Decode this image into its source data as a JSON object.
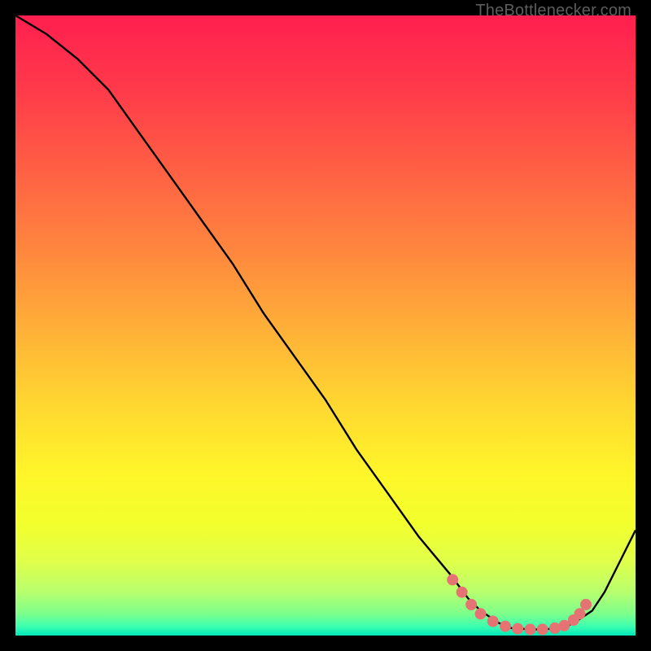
{
  "watermark": "TheBottlenecker.com",
  "chart_data": {
    "type": "line",
    "title": "",
    "xlabel": "",
    "ylabel": "",
    "xlim": [
      0,
      100
    ],
    "ylim": [
      0,
      100
    ],
    "grid": false,
    "series": [
      {
        "name": "curve",
        "color": "#000000",
        "x": [
          0,
          5,
          10,
          15,
          20,
          25,
          30,
          35,
          40,
          45,
          50,
          55,
          60,
          65,
          70,
          73,
          75,
          78,
          80,
          83,
          85,
          88,
          90,
          93,
          95,
          100
        ],
        "y": [
          100,
          97,
          93,
          88,
          81,
          74,
          67,
          60,
          52,
          45,
          38,
          30,
          23,
          16,
          10,
          6,
          4,
          2,
          1.2,
          1.0,
          1.0,
          1.2,
          2,
          4,
          7,
          17
        ]
      }
    ],
    "markers": {
      "name": "highlight-dots",
      "color": "#e57373",
      "points": [
        {
          "x": 70.5,
          "y": 9
        },
        {
          "x": 72,
          "y": 7
        },
        {
          "x": 73.5,
          "y": 5
        },
        {
          "x": 75,
          "y": 3.5
        },
        {
          "x": 77,
          "y": 2.3
        },
        {
          "x": 79,
          "y": 1.5
        },
        {
          "x": 81,
          "y": 1.1
        },
        {
          "x": 83,
          "y": 1.0
        },
        {
          "x": 85,
          "y": 1.0
        },
        {
          "x": 87,
          "y": 1.2
        },
        {
          "x": 88.5,
          "y": 1.6
        },
        {
          "x": 90,
          "y": 2.5
        },
        {
          "x": 91,
          "y": 3.5
        },
        {
          "x": 92,
          "y": 5
        }
      ]
    },
    "background_gradient": {
      "type": "vertical",
      "stops": [
        {
          "offset": 0.0,
          "color": "#ff1f4f"
        },
        {
          "offset": 0.12,
          "color": "#ff3a4a"
        },
        {
          "offset": 0.25,
          "color": "#ff6044"
        },
        {
          "offset": 0.38,
          "color": "#ff873e"
        },
        {
          "offset": 0.5,
          "color": "#ffae38"
        },
        {
          "offset": 0.62,
          "color": "#ffd531"
        },
        {
          "offset": 0.74,
          "color": "#fff62a"
        },
        {
          "offset": 0.82,
          "color": "#f2ff2d"
        },
        {
          "offset": 0.88,
          "color": "#e0ff4a"
        },
        {
          "offset": 0.93,
          "color": "#b8ff6e"
        },
        {
          "offset": 0.965,
          "color": "#7dff8c"
        },
        {
          "offset": 0.985,
          "color": "#3dffb0"
        },
        {
          "offset": 1.0,
          "color": "#00e7b8"
        }
      ]
    }
  }
}
